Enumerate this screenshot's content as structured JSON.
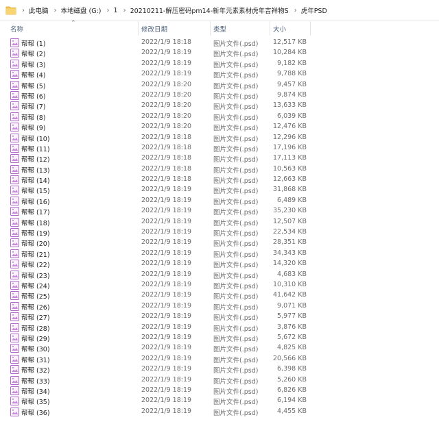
{
  "breadcrumb": [
    "此电脑",
    "本地磁盘 (G:)",
    "1",
    "20210211-解压密码pm14-新年元素素材虎年吉祥物S",
    "虎年PSD"
  ],
  "columns": {
    "name": "名称",
    "date": "修改日期",
    "type": "类型",
    "size": "大小"
  },
  "colors": {
    "icon_stroke": "#b069c8",
    "folder_yellow": "#f4c44e"
  },
  "files": [
    {
      "name": "帮帮 (1)",
      "date": "2022/1/9 18:18",
      "type": "图片文件(.psd)",
      "size": "12,517 KB"
    },
    {
      "name": "帮帮 (2)",
      "date": "2022/1/9 18:19",
      "type": "图片文件(.psd)",
      "size": "10,284 KB"
    },
    {
      "name": "帮帮 (3)",
      "date": "2022/1/9 18:19",
      "type": "图片文件(.psd)",
      "size": "9,182 KB"
    },
    {
      "name": "帮帮 (4)",
      "date": "2022/1/9 18:19",
      "type": "图片文件(.psd)",
      "size": "9,788 KB"
    },
    {
      "name": "帮帮 (5)",
      "date": "2022/1/9 18:20",
      "type": "图片文件(.psd)",
      "size": "9,457 KB"
    },
    {
      "name": "帮帮 (6)",
      "date": "2022/1/9 18:20",
      "type": "图片文件(.psd)",
      "size": "9,874 KB"
    },
    {
      "name": "帮帮 (7)",
      "date": "2022/1/9 18:20",
      "type": "图片文件(.psd)",
      "size": "13,633 KB"
    },
    {
      "name": "帮帮 (8)",
      "date": "2022/1/9 18:20",
      "type": "图片文件(.psd)",
      "size": "6,039 KB"
    },
    {
      "name": "帮帮 (9)",
      "date": "2022/1/9 18:20",
      "type": "图片文件(.psd)",
      "size": "12,476 KB"
    },
    {
      "name": "帮帮 (10)",
      "date": "2022/1/9 18:18",
      "type": "图片文件(.psd)",
      "size": "12,296 KB"
    },
    {
      "name": "帮帮 (11)",
      "date": "2022/1/9 18:18",
      "type": "图片文件(.psd)",
      "size": "17,196 KB"
    },
    {
      "name": "帮帮 (12)",
      "date": "2022/1/9 18:18",
      "type": "图片文件(.psd)",
      "size": "17,113 KB"
    },
    {
      "name": "帮帮 (13)",
      "date": "2022/1/9 18:18",
      "type": "图片文件(.psd)",
      "size": "10,563 KB"
    },
    {
      "name": "帮帮 (14)",
      "date": "2022/1/9 18:18",
      "type": "图片文件(.psd)",
      "size": "12,663 KB"
    },
    {
      "name": "帮帮 (15)",
      "date": "2022/1/9 18:19",
      "type": "图片文件(.psd)",
      "size": "31,868 KB"
    },
    {
      "name": "帮帮 (16)",
      "date": "2022/1/9 18:19",
      "type": "图片文件(.psd)",
      "size": "6,489 KB"
    },
    {
      "name": "帮帮 (17)",
      "date": "2022/1/9 18:19",
      "type": "图片文件(.psd)",
      "size": "35,230 KB"
    },
    {
      "name": "帮帮 (18)",
      "date": "2022/1/9 18:19",
      "type": "图片文件(.psd)",
      "size": "12,507 KB"
    },
    {
      "name": "帮帮 (19)",
      "date": "2022/1/9 18:19",
      "type": "图片文件(.psd)",
      "size": "22,534 KB"
    },
    {
      "name": "帮帮 (20)",
      "date": "2022/1/9 18:19",
      "type": "图片文件(.psd)",
      "size": "28,351 KB"
    },
    {
      "name": "帮帮 (21)",
      "date": "2022/1/9 18:19",
      "type": "图片文件(.psd)",
      "size": "34,343 KB"
    },
    {
      "name": "帮帮 (22)",
      "date": "2022/1/9 18:19",
      "type": "图片文件(.psd)",
      "size": "14,320 KB"
    },
    {
      "name": "帮帮 (23)",
      "date": "2022/1/9 18:19",
      "type": "图片文件(.psd)",
      "size": "4,683 KB"
    },
    {
      "name": "帮帮 (24)",
      "date": "2022/1/9 18:19",
      "type": "图片文件(.psd)",
      "size": "10,310 KB"
    },
    {
      "name": "帮帮 (25)",
      "date": "2022/1/9 18:19",
      "type": "图片文件(.psd)",
      "size": "41,642 KB"
    },
    {
      "name": "帮帮 (26)",
      "date": "2022/1/9 18:19",
      "type": "图片文件(.psd)",
      "size": "9,071 KB"
    },
    {
      "name": "帮帮 (27)",
      "date": "2022/1/9 18:19",
      "type": "图片文件(.psd)",
      "size": "5,977 KB"
    },
    {
      "name": "帮帮 (28)",
      "date": "2022/1/9 18:19",
      "type": "图片文件(.psd)",
      "size": "3,876 KB"
    },
    {
      "name": "帮帮 (29)",
      "date": "2022/1/9 18:19",
      "type": "图片文件(.psd)",
      "size": "5,672 KB"
    },
    {
      "name": "帮帮 (30)",
      "date": "2022/1/9 18:19",
      "type": "图片文件(.psd)",
      "size": "4,825 KB"
    },
    {
      "name": "帮帮 (31)",
      "date": "2022/1/9 18:19",
      "type": "图片文件(.psd)",
      "size": "20,566 KB"
    },
    {
      "name": "帮帮 (32)",
      "date": "2022/1/9 18:19",
      "type": "图片文件(.psd)",
      "size": "6,398 KB"
    },
    {
      "name": "帮帮 (33)",
      "date": "2022/1/9 18:19",
      "type": "图片文件(.psd)",
      "size": "5,260 KB"
    },
    {
      "name": "帮帮 (34)",
      "date": "2022/1/9 18:19",
      "type": "图片文件(.psd)",
      "size": "6,826 KB"
    },
    {
      "name": "帮帮 (35)",
      "date": "2022/1/9 18:19",
      "type": "图片文件(.psd)",
      "size": "6,194 KB"
    },
    {
      "name": "帮帮 (36)",
      "date": "2022/1/9 18:19",
      "type": "图片文件(.psd)",
      "size": "4,455 KB"
    }
  ]
}
